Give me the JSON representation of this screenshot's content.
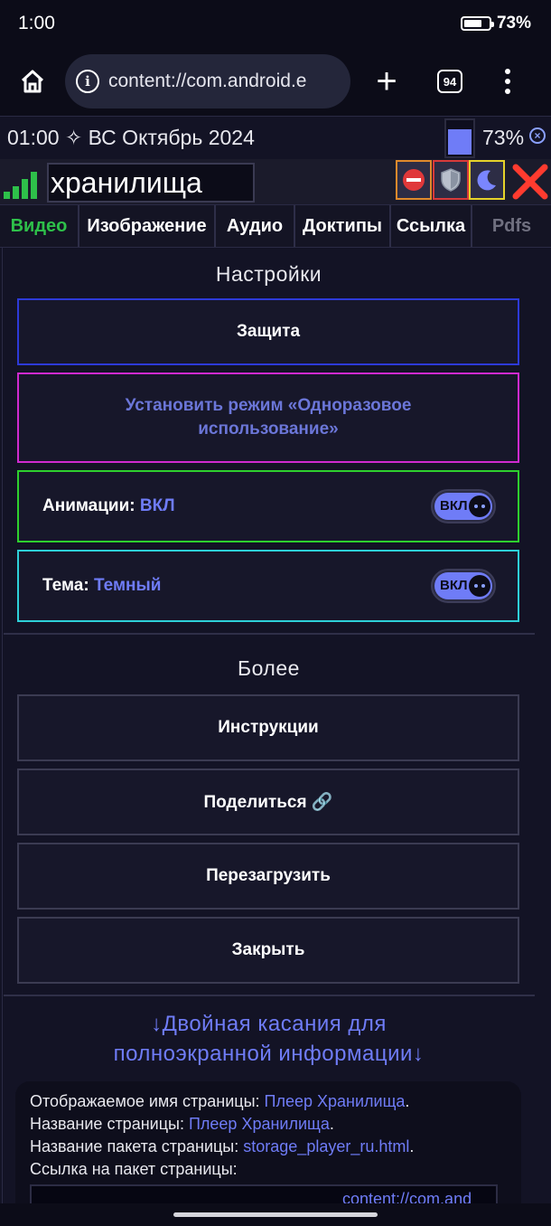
{
  "status_bar": {
    "time": "1:00",
    "battery_pct": "73%",
    "battery_level": 0.73
  },
  "browser": {
    "url": "content://com.android.e",
    "tab_count": "94"
  },
  "header": {
    "datetime": "01:00 ✧ ВС Октябрь 2024",
    "battery_pct": "73%",
    "page_name": "хранилища"
  },
  "tabs": [
    {
      "label": "Видео",
      "active": true
    },
    {
      "label": "Изображение"
    },
    {
      "label": "Аудио"
    },
    {
      "label": "Доктипы"
    },
    {
      "label": "Ссылка"
    },
    {
      "label": "Pdfs",
      "dim": true
    }
  ],
  "settings": {
    "title": "Настройки",
    "protection_label": "Защита",
    "single_use_label": "Установить режим «Одноразовое использование»",
    "animations_label": "Анимации:",
    "animations_value": "ВКЛ",
    "theme_label": "Тема:",
    "theme_value": "Темный",
    "toggle_text": "ВКЛ"
  },
  "more": {
    "title": "Более",
    "instructions": "Инструкции",
    "share": "Поделиться 🔗",
    "reload": "Перезагрузить",
    "close": "Закрыть"
  },
  "info": {
    "hint": "↓Двойная касания для полноэкранной информации↓",
    "display_name_label": "Отображаемое имя страницы:",
    "display_name_value": "Плеер Хранилища",
    "page_name_label": "Название страницы:",
    "page_name_value": "Плеер Хранилища",
    "package_name_label": "Название пакета страницы:",
    "package_name_value": "storage_player_ru.html",
    "package_link_label": "Ссылка на пакет страницы:",
    "package_link_value": "content://com.and"
  },
  "colors": {
    "accent": "#6f7cf7",
    "active_tab": "#2ec04a",
    "background": "#131325"
  },
  "icons": [
    "home-icon",
    "info-icon",
    "plus-icon",
    "tabs-icon",
    "more-vert-icon",
    "signal-icon",
    "stop-icon",
    "shield-icon",
    "moon-icon",
    "close-icon",
    "link-icon"
  ]
}
